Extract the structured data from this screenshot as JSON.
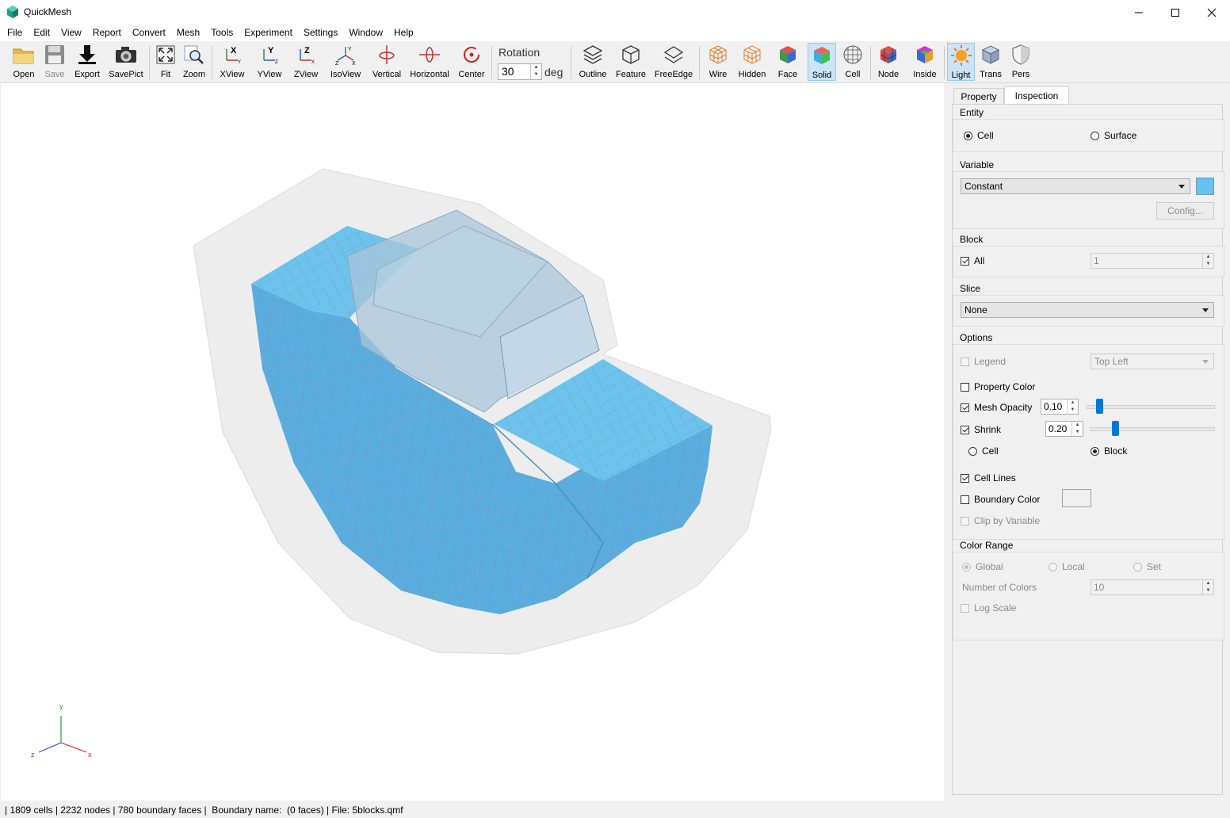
{
  "window": {
    "title": "QuickMesh",
    "minimize_icon": "minimize-icon",
    "maximize_icon": "maximize-icon",
    "close_icon": "close-icon"
  },
  "menu": [
    "File",
    "Edit",
    "View",
    "Report",
    "Convert",
    "Mesh",
    "Tools",
    "Experiment",
    "Settings",
    "Window",
    "Help"
  ],
  "toolbar": {
    "open": "Open",
    "save": "Save",
    "export": "Export",
    "savepict": "SavePict",
    "fit": "Fit",
    "zoom": "Zoom",
    "xview": "XView",
    "yview": "YView",
    "zview": "ZView",
    "isoview": "IsoView",
    "vertical": "Vertical",
    "horizontal": "Horizontal",
    "center": "Center",
    "rotation_label": "Rotation",
    "rotation_value": "30",
    "rotation_unit": "deg",
    "outline": "Outline",
    "feature": "Feature",
    "freeedge": "FreeEdge",
    "wire": "Wire",
    "hidden": "Hidden",
    "face": "Face",
    "solid": "Solid",
    "cell": "Cell",
    "node": "Node",
    "inside": "Inside",
    "light": "Light",
    "trans": "Trans",
    "pers": "Pers"
  },
  "panel": {
    "tabs": [
      "Property",
      "Inspection"
    ],
    "active_tab": "Inspection",
    "entity": {
      "title": "Entity",
      "cell": "Cell",
      "surface": "Surface",
      "selected": "Cell"
    },
    "variable": {
      "title": "Variable",
      "value": "Constant",
      "color": "#66c2f0",
      "config": "Config..."
    },
    "block": {
      "title": "Block",
      "all_label": "All",
      "all_checked": true,
      "value": "1"
    },
    "slice": {
      "title": "Slice",
      "value": "None"
    },
    "options": {
      "title": "Options",
      "legend": "Legend",
      "legend_position": "Top Left",
      "property_color": "Property Color",
      "mesh_opacity": "Mesh Opacity",
      "mesh_opacity_value": "0.10",
      "mesh_opacity_level": 0.1,
      "shrink": "Shrink",
      "shrink_value": "0.20",
      "shrink_level": 0.2,
      "shrink_cell": "Cell",
      "shrink_block": "Block",
      "shrink_mode": "Block",
      "cell_lines": "Cell Lines",
      "boundary_color": "Boundary Color",
      "boundary_color_value": "#f0f0f0",
      "clip_by_variable": "Clip by Variable"
    },
    "color_range": {
      "title": "Color Range",
      "global": "Global",
      "local": "Local",
      "set": "Set",
      "number_of_colors": "Number of Colors",
      "number_of_colors_value": "10",
      "log_scale": "Log Scale"
    }
  },
  "axes": {
    "x": "x",
    "y": "y",
    "z": "z"
  },
  "status": "| 1809 cells | 2232 nodes | 780 boundary faces |  Boundary name:  (0 faces) | File: 5blocks.qmf",
  "colors": {
    "mesh": "#5aaee0",
    "mesh_top": "#6bc0ec",
    "accent": "#0078d7",
    "active_bg": "#cce4f7"
  }
}
